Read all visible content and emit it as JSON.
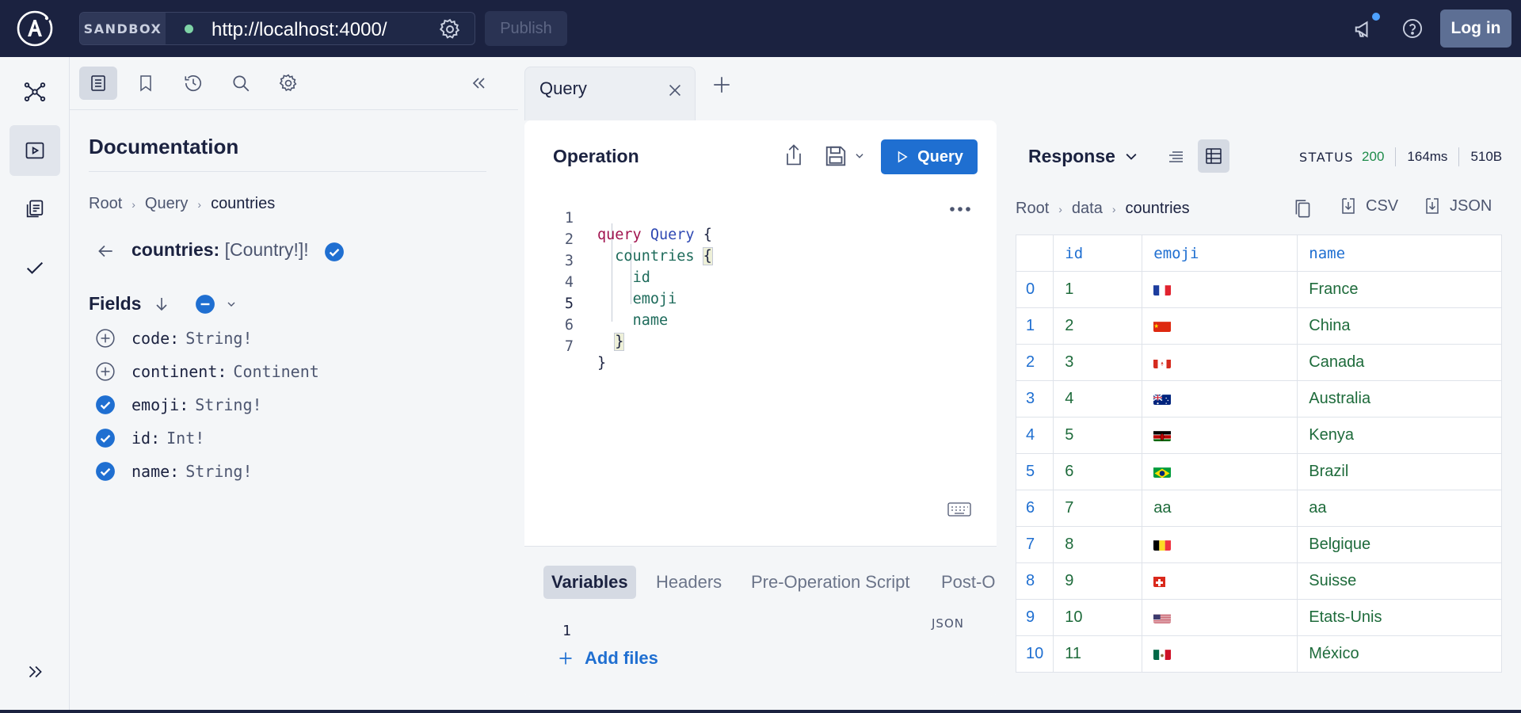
{
  "topbar": {
    "sandbox_label": "SANDBOX",
    "url": "http://localhost:4000/",
    "publish_label": "Publish",
    "login_label": "Log in"
  },
  "docs": {
    "title": "Documentation",
    "breadcrumbs": [
      "Root",
      "Query",
      "countries"
    ],
    "type_name": "countries:",
    "type_value": "[Country!]!",
    "fields_label": "Fields",
    "fields": [
      {
        "name": "code:",
        "type": "String!",
        "selected": false
      },
      {
        "name": "continent:",
        "type": "Continent",
        "selected": false
      },
      {
        "name": "emoji:",
        "type": "String!",
        "selected": true
      },
      {
        "name": "id:",
        "type": "Int!",
        "selected": true
      },
      {
        "name": "name:",
        "type": "String!",
        "selected": true
      }
    ]
  },
  "tabs": [
    {
      "label": "Query"
    }
  ],
  "operation": {
    "title": "Operation",
    "run_label": "Query",
    "code": {
      "l1_kw": "query",
      "l1_name": "Query",
      "l1_brace": "{",
      "l2": "countries",
      "l2_brace": "{",
      "l3": "id",
      "l4": "emoji",
      "l5": "name",
      "l6": "}",
      "l7": "}"
    },
    "line_numbers": [
      "1",
      "2",
      "3",
      "4",
      "5",
      "6",
      "7"
    ],
    "bottom_tabs": [
      "Variables",
      "Headers",
      "Pre-Operation Script",
      "Post-O"
    ],
    "variables_format": "JSON",
    "variables_line": "1",
    "add_files_label": "Add files"
  },
  "response": {
    "title": "Response",
    "status_label": "STATUS",
    "status_code": "200",
    "time": "164ms",
    "size": "510B",
    "breadcrumbs": [
      "Root",
      "data",
      "countries"
    ],
    "csv_label": "CSV",
    "json_label": "JSON",
    "columns": [
      "id",
      "emoji",
      "name"
    ],
    "rows": [
      {
        "idx": "0",
        "id": "1",
        "emoji": "flag-france",
        "name": "France"
      },
      {
        "idx": "1",
        "id": "2",
        "emoji": "flag-china",
        "name": "China"
      },
      {
        "idx": "2",
        "id": "3",
        "emoji": "flag-canada",
        "name": "Canada"
      },
      {
        "idx": "3",
        "id": "4",
        "emoji": "flag-australia",
        "name": "Australia"
      },
      {
        "idx": "4",
        "id": "5",
        "emoji": "flag-kenya",
        "name": "Kenya"
      },
      {
        "idx": "5",
        "id": "6",
        "emoji": "flag-brazil",
        "name": "Brazil"
      },
      {
        "idx": "6",
        "id": "7",
        "emoji": "aa",
        "name": "aa"
      },
      {
        "idx": "7",
        "id": "8",
        "emoji": "flag-belgium",
        "name": "Belgique"
      },
      {
        "idx": "8",
        "id": "9",
        "emoji": "flag-switzerland",
        "name": "Suisse"
      },
      {
        "idx": "9",
        "id": "10",
        "emoji": "flag-usa",
        "name": "Etats-Unis"
      },
      {
        "idx": "10",
        "id": "11",
        "emoji": "flag-mexico",
        "name": "México"
      }
    ]
  },
  "colors": {
    "navy": "#1b2240",
    "accent_blue": "#1f6fd1",
    "status_green": "#1e8b4a"
  }
}
